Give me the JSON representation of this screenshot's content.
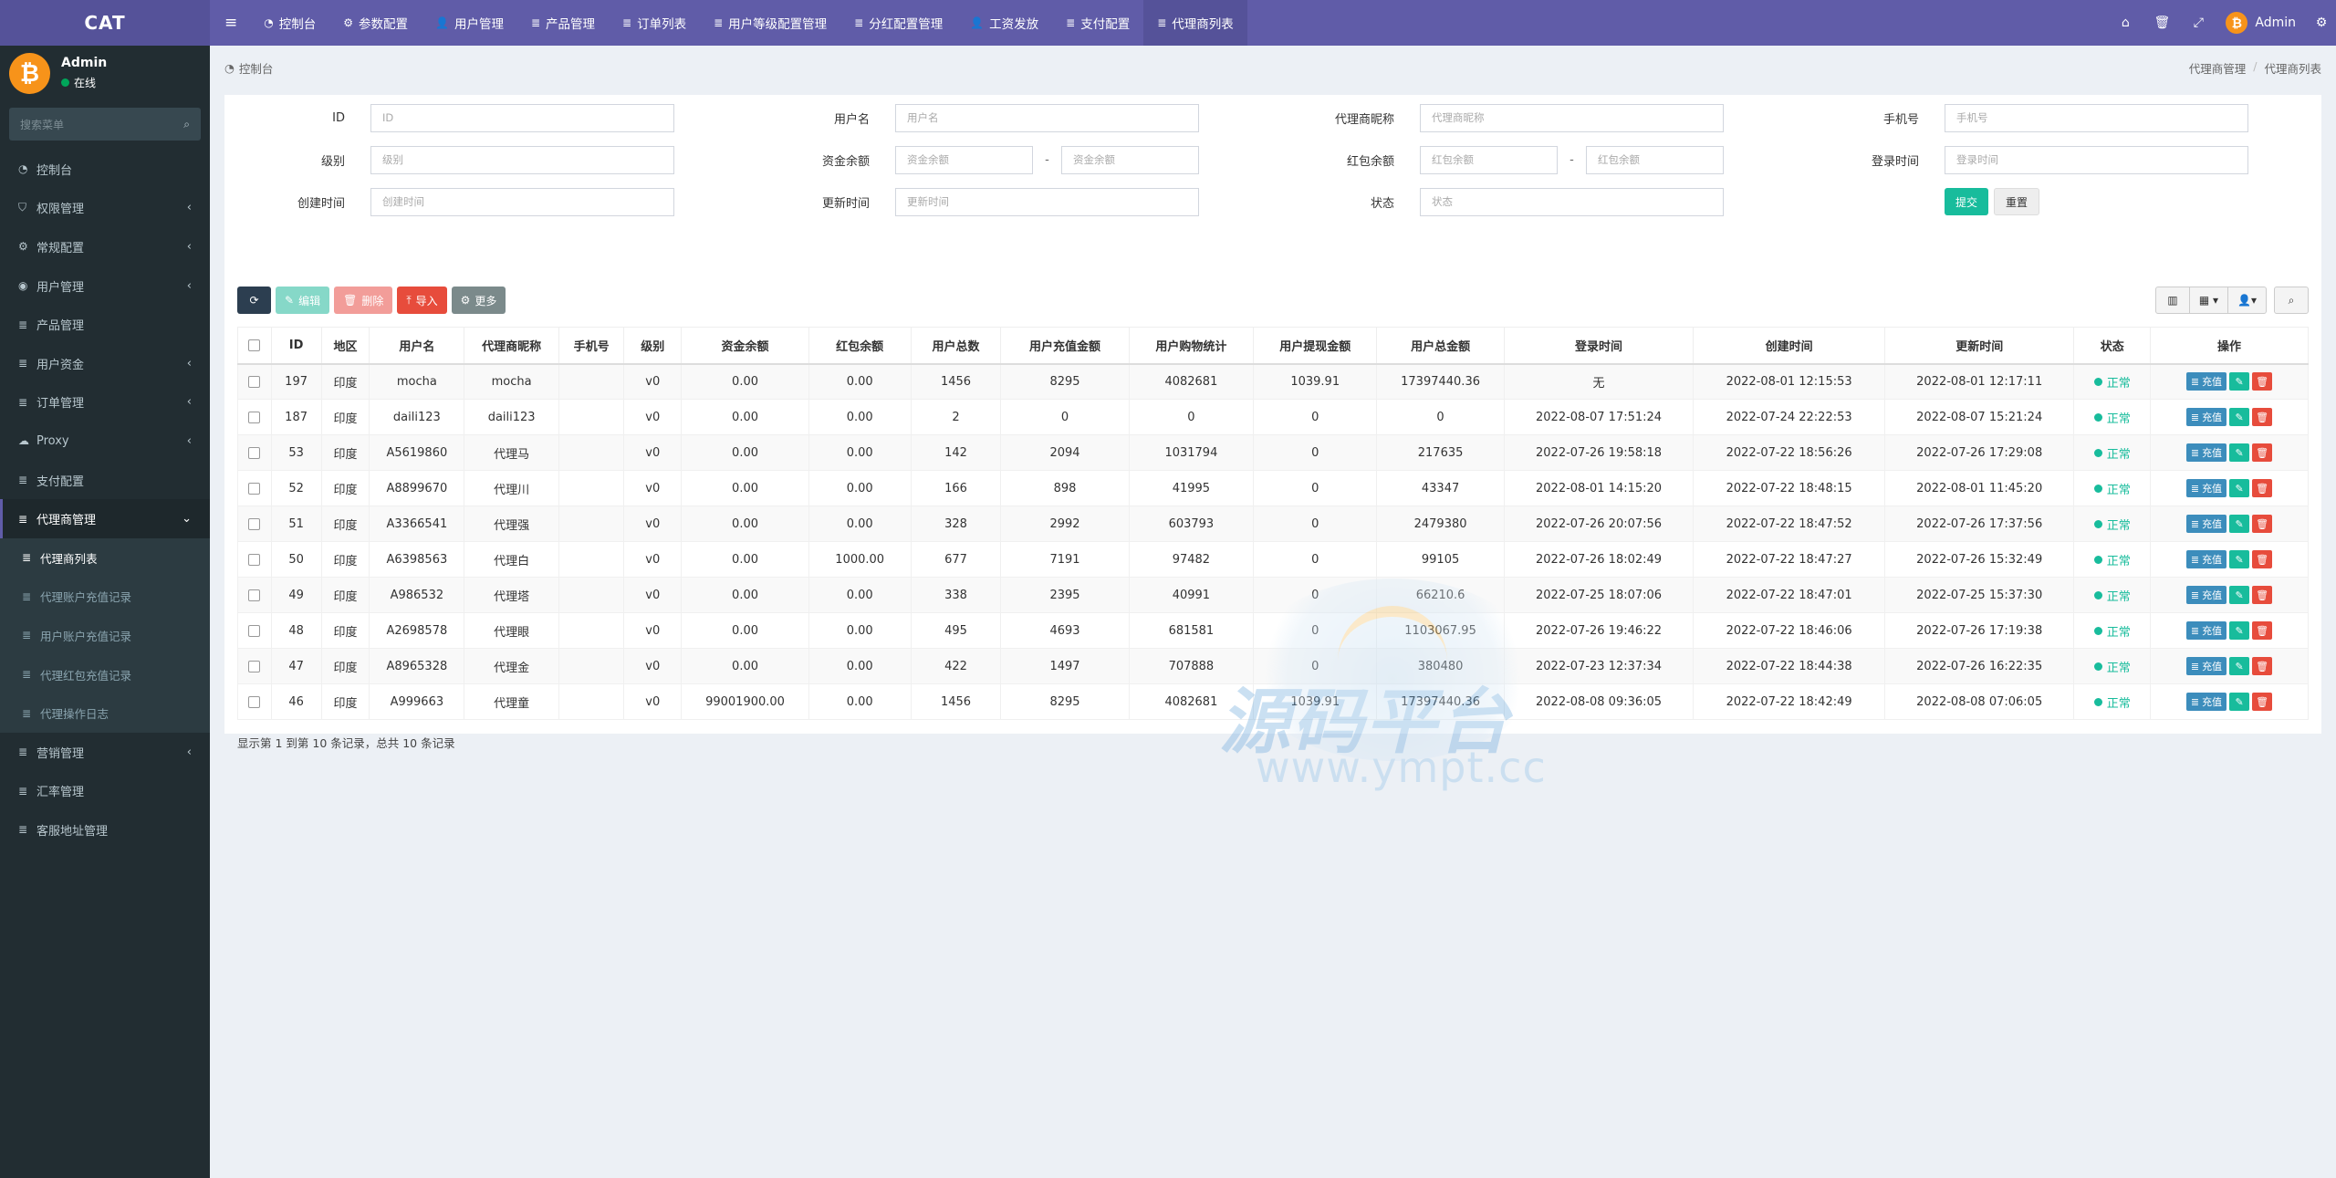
{
  "brand": "CAT",
  "topnav": [
    {
      "icon": "dashboard-icon",
      "glyph": "◔",
      "label": "控制台"
    },
    {
      "icon": "gears-icon",
      "glyph": "⚙",
      "label": "参数配置"
    },
    {
      "icon": "user-icon",
      "glyph": "👤",
      "label": "用户管理"
    },
    {
      "icon": "list-icon",
      "glyph": "≣",
      "label": "产品管理"
    },
    {
      "icon": "list-icon",
      "glyph": "≣",
      "label": "订单列表"
    },
    {
      "icon": "list-icon",
      "glyph": "≣",
      "label": "用户等级配置管理"
    },
    {
      "icon": "list-icon",
      "glyph": "≣",
      "label": "分红配置管理"
    },
    {
      "icon": "user-icon",
      "glyph": "👤",
      "label": "工资发放"
    },
    {
      "icon": "list-icon",
      "glyph": "≣",
      "label": "支付配置"
    },
    {
      "icon": "list-icon",
      "glyph": "≣",
      "label": "代理商列表"
    }
  ],
  "topright": {
    "user": "Admin"
  },
  "user_panel": {
    "name": "Admin",
    "status": "在线"
  },
  "sidebar": {
    "search_placeholder": "搜索菜单",
    "items": [
      {
        "label": "控制台",
        "glyph": "◔",
        "icon": "dashboard-icon",
        "chevron": false
      },
      {
        "label": "权限管理",
        "glyph": "⛉",
        "icon": "shield-icon",
        "chevron": true
      },
      {
        "label": "常规配置",
        "glyph": "⚙",
        "icon": "cogs-icon",
        "chevron": true
      },
      {
        "label": "用户管理",
        "glyph": "◉",
        "icon": "user-circle-icon",
        "chevron": true
      },
      {
        "label": "产品管理",
        "glyph": "≣",
        "icon": "list-icon",
        "chevron": false
      },
      {
        "label": "用户资金",
        "glyph": "≣",
        "icon": "list-icon",
        "chevron": true
      },
      {
        "label": "订单管理",
        "glyph": "≣",
        "icon": "list-icon",
        "chevron": true
      },
      {
        "label": "Proxy",
        "glyph": "☁",
        "icon": "cloud-icon",
        "chevron": true
      },
      {
        "label": "支付配置",
        "glyph": "≣",
        "icon": "list-icon",
        "chevron": false
      },
      {
        "label": "代理商管理",
        "glyph": "≣",
        "icon": "list-icon",
        "chevron": true,
        "open": true
      }
    ],
    "sub_items": [
      {
        "label": "代理商列表",
        "current": true
      },
      {
        "label": "代理账户充值记录",
        "current": false
      },
      {
        "label": "用户账户充值记录",
        "current": false
      },
      {
        "label": "代理红包充值记录",
        "current": false
      },
      {
        "label": "代理操作日志",
        "current": false
      }
    ],
    "items_after": [
      {
        "label": "营销管理",
        "glyph": "≣",
        "icon": "list-icon",
        "chevron": true
      },
      {
        "label": "汇率管理",
        "glyph": "≣",
        "icon": "list-icon",
        "chevron": false
      },
      {
        "label": "客服地址管理",
        "glyph": "≣",
        "icon": "list-icon",
        "chevron": false
      }
    ]
  },
  "crumb": {
    "home": "控制台",
    "path": [
      "代理商管理",
      "代理商列表"
    ]
  },
  "filters": {
    "id": {
      "label": "ID",
      "placeholder": "ID"
    },
    "username": {
      "label": "用户名",
      "placeholder": "用户名"
    },
    "nickname": {
      "label": "代理商昵称",
      "placeholder": "代理商昵称"
    },
    "phone": {
      "label": "手机号",
      "placeholder": "手机号"
    },
    "level": {
      "label": "级别",
      "placeholder": "级别"
    },
    "balance": {
      "label": "资金余额",
      "placeholder_min": "资金余额",
      "placeholder_max": "资金余额"
    },
    "redpacket": {
      "label": "红包余额",
      "placeholder_min": "红包余额",
      "placeholder_max": "红包余额"
    },
    "logintime": {
      "label": "登录时间",
      "placeholder": "登录时间"
    },
    "createtime": {
      "label": "创建时间",
      "placeholder": "创建时间"
    },
    "updatetime": {
      "label": "更新时间",
      "placeholder": "更新时间"
    },
    "status": {
      "label": "状态",
      "placeholder": "状态"
    },
    "range_sep": "-",
    "submit": "提交",
    "reset": "重置"
  },
  "toolbar": {
    "edit": "编辑",
    "delete": "删除",
    "import": "导入",
    "more": "更多"
  },
  "table": {
    "columns": [
      "ID",
      "地区",
      "用户名",
      "代理商昵称",
      "手机号",
      "级别",
      "资金余额",
      "红包余额",
      "用户总数",
      "用户充值金额",
      "用户购物统计",
      "用户提现金额",
      "用户总金额",
      "登录时间",
      "创建时间",
      "更新时间",
      "状态",
      "操作"
    ],
    "recharge_label": "充值",
    "rows": [
      [
        "197",
        "印度",
        "mocha",
        "mocha",
        "",
        "v0",
        "0.00",
        "0.00",
        "1456",
        "8295",
        "4082681",
        "1039.91",
        "17397440.36",
        "无",
        "2022-08-01 12:15:53",
        "2022-08-01 12:17:11",
        "正常"
      ],
      [
        "187",
        "印度",
        "daili123",
        "daili123",
        "",
        "v0",
        "0.00",
        "0.00",
        "2",
        "0",
        "0",
        "0",
        "0",
        "2022-08-07 17:51:24",
        "2022-07-24 22:22:53",
        "2022-08-07 15:21:24",
        "正常"
      ],
      [
        "53",
        "印度",
        "A5619860",
        "代理马",
        "",
        "v0",
        "0.00",
        "0.00",
        "142",
        "2094",
        "1031794",
        "0",
        "217635",
        "2022-07-26 19:58:18",
        "2022-07-22 18:56:26",
        "2022-07-26 17:29:08",
        "正常"
      ],
      [
        "52",
        "印度",
        "A8899670",
        "代理川",
        "",
        "v0",
        "0.00",
        "0.00",
        "166",
        "898",
        "41995",
        "0",
        "43347",
        "2022-08-01 14:15:20",
        "2022-07-22 18:48:15",
        "2022-08-01 11:45:20",
        "正常"
      ],
      [
        "51",
        "印度",
        "A3366541",
        "代理强",
        "",
        "v0",
        "0.00",
        "0.00",
        "328",
        "2992",
        "603793",
        "0",
        "2479380",
        "2022-07-26 20:07:56",
        "2022-07-22 18:47:52",
        "2022-07-26 17:37:56",
        "正常"
      ],
      [
        "50",
        "印度",
        "A6398563",
        "代理白",
        "",
        "v0",
        "0.00",
        "1000.00",
        "677",
        "7191",
        "97482",
        "0",
        "99105",
        "2022-07-26 18:02:49",
        "2022-07-22 18:47:27",
        "2022-07-26 15:32:49",
        "正常"
      ],
      [
        "49",
        "印度",
        "A986532",
        "代理塔",
        "",
        "v0",
        "0.00",
        "0.00",
        "338",
        "2395",
        "40991",
        "0",
        "66210.6",
        "2022-07-25 18:07:06",
        "2022-07-22 18:47:01",
        "2022-07-25 15:37:30",
        "正常"
      ],
      [
        "48",
        "印度",
        "A2698578",
        "代理眼",
        "",
        "v0",
        "0.00",
        "0.00",
        "495",
        "4693",
        "681581",
        "0",
        "1103067.95",
        "2022-07-26 19:46:22",
        "2022-07-22 18:46:06",
        "2022-07-26 17:19:38",
        "正常"
      ],
      [
        "47",
        "印度",
        "A8965328",
        "代理金",
        "",
        "v0",
        "0.00",
        "0.00",
        "422",
        "1497",
        "707888",
        "0",
        "380480",
        "2022-07-23 12:37:34",
        "2022-07-22 18:44:38",
        "2022-07-26 16:22:35",
        "正常"
      ],
      [
        "46",
        "印度",
        "A999663",
        "代理童",
        "",
        "v0",
        "99001900.00",
        "0.00",
        "1456",
        "8295",
        "4082681",
        "1039.91",
        "17397440.36",
        "2022-08-08 09:36:05",
        "2022-07-22 18:42:49",
        "2022-08-08 07:06:05",
        "正常"
      ]
    ]
  },
  "pageinfo": "显示第 1 到第 10 条记录，总共 10 条记录",
  "watermark": {
    "title": "源码平台",
    "url": "www.ympt.cc"
  },
  "colors": {
    "topbar": "#605ca8",
    "sidebar": "#222d32",
    "success": "#18bc9c",
    "danger": "#e74c3c",
    "primary": "#3c8dbc"
  }
}
